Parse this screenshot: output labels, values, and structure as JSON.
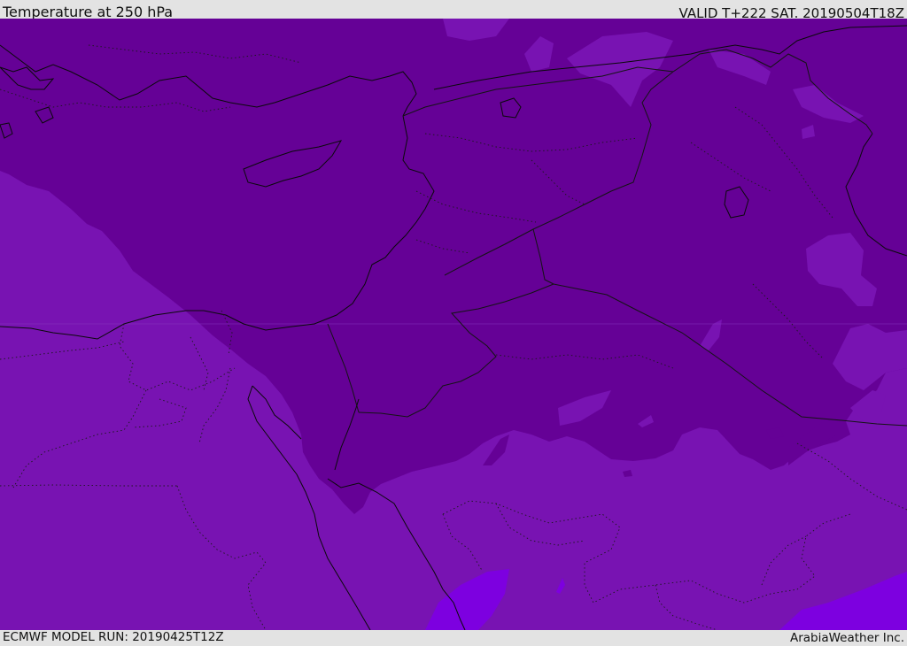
{
  "header": {
    "title": "Temperature at 250 hPa",
    "valid": "VALID T+222 SAT. 20190504T18Z"
  },
  "footer": {
    "model_run": "ECMWF MODEL RUN: 20190425T12Z",
    "credit": "ArabiaWeather Inc."
  },
  "map": {
    "field": "Temperature at 250 hPa",
    "colors": {
      "colder_band": "#650196",
      "middle_band": "#7813b2",
      "warm_band": "#7d00e0",
      "light_patch": "#8a2ac4",
      "coastline": "#0a0a0a",
      "border": "#141414"
    }
  }
}
